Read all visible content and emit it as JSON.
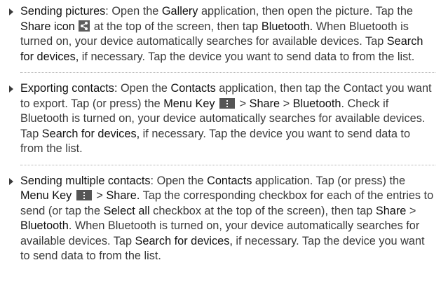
{
  "items": [
    {
      "t1": "Sending pictures",
      "t2": ": Open the ",
      "t3": "Gallery",
      "t4": " application, then open the picture. Tap the ",
      "t5": "Share icon",
      "t6": " at the top of the screen, then tap ",
      "t7": "Bluetooth.",
      "t8": " When Bluetooth is turned on, your device automatically searches for available devices. Tap ",
      "t9": "Search for devices,",
      "t10": " if necessary. Tap the device you want to send data to from the list."
    },
    {
      "t1": "Exporting contacts:",
      "t2": " Open the ",
      "t3": "Contacts",
      "t4": " application, then tap the Contact you want to export. Tap (or press) the ",
      "t5": "Menu Key",
      "t6": " > ",
      "t7": "Share",
      "t8": " > ",
      "t9": "Bluetooth",
      "t10": ". Check if Bluetooth is turned on, your device automatically searches for available devices. Tap ",
      "t11": "Search for devices,",
      "t12": " if necessary. Tap the device you want to send data to from the list."
    },
    {
      "t1": "Sending multiple contacts",
      "t2": ": Open the ",
      "t3": "Contacts",
      "t4": " application. Tap (or press) the ",
      "t5": "Menu Key",
      "t6": " > ",
      "t7": "Share.",
      "t8": " Tap the corresponding checkbox for each of the entries to send (or tap the ",
      "t9": "Select all",
      "t10": " checkbox at the top of the screen), then tap ",
      "t11": "Share",
      "t12": " > ",
      "t13": "Bluetooth",
      "t14": ". When Bluetooth is turned on, your device automatically searches for available devices. Tap ",
      "t15": "Search for devices,",
      "t16": " if necessary. Tap the device you want to send data to from the list."
    }
  ],
  "icons": {
    "share": "share-icon",
    "menu": "menu-key-icon"
  }
}
